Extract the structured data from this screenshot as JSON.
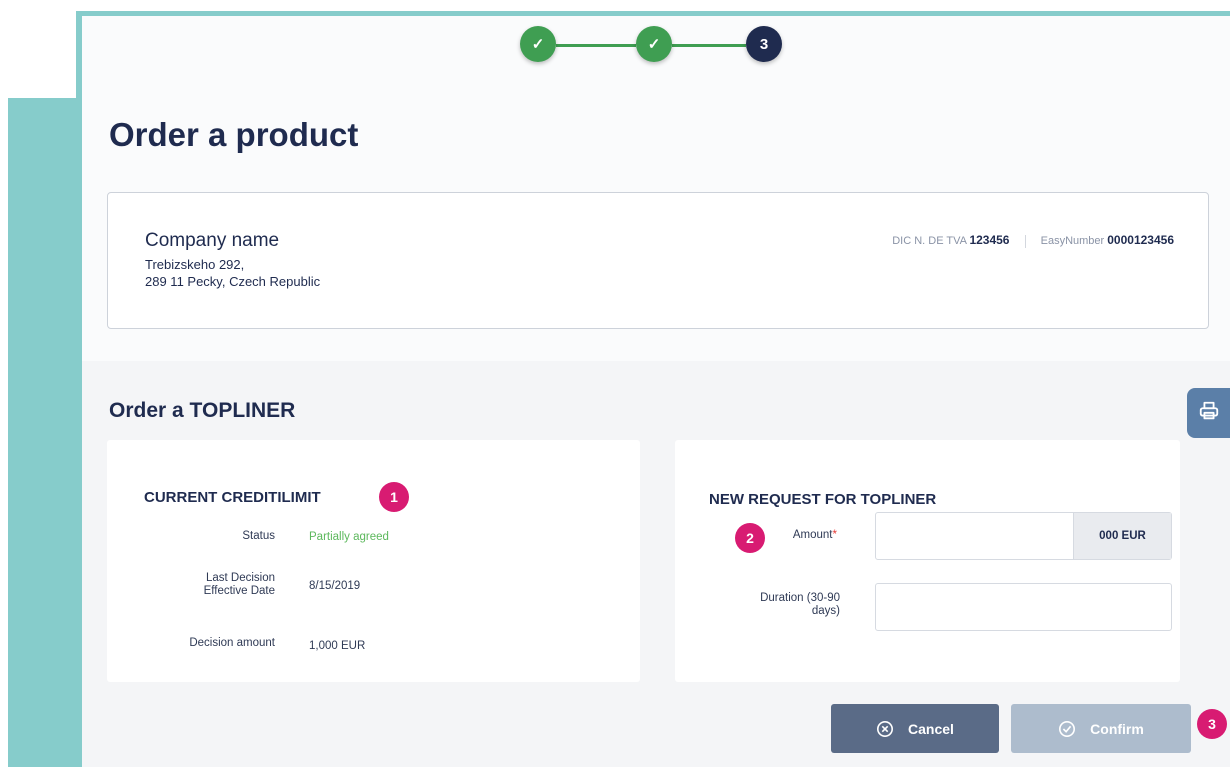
{
  "stepper": {
    "steps": [
      "✓",
      "✓",
      "3"
    ],
    "current_step": 3
  },
  "page_title": "Order a product",
  "company": {
    "name": "Company name",
    "address_line1": "Trebizskeho 292,",
    "address_line2": "289 11 Pecky, Czech Republic",
    "dic_label": "DIC N. DE TVA",
    "dic_value": "123456",
    "easy_label": "EasyNumber",
    "easy_value": "0000123456"
  },
  "section_title": "Order a TOPLINER",
  "print_icon": "printer-icon",
  "current_limit": {
    "title": "CURRENT CREDITILIMIT",
    "badge": "1",
    "status_label": "Status",
    "status_value": "Partially agreed",
    "last_decision_label_line1": "Last Decision",
    "last_decision_label_line2": "Effective Date",
    "last_decision_value": "8/15/2019",
    "decision_amount_label": "Decision amount",
    "decision_amount_value": "1,000 EUR"
  },
  "new_request": {
    "title": "NEW REQUEST FOR TOPLINER",
    "badge": "2",
    "amount_label": "Amount",
    "amount_required": "*",
    "amount_value": "",
    "amount_suffix": "000 EUR",
    "duration_label_line1": "Duration (30-90",
    "duration_label_line2": "days)",
    "duration_value": ""
  },
  "actions": {
    "cancel_label": "Cancel",
    "confirm_label": "Confirm",
    "badge": "3"
  },
  "colors": {
    "accent_teal": "#86cccb",
    "step_done": "#3f9e52",
    "step_current": "#1f2b4f",
    "badge": "#d81b72",
    "status_green": "#5cb85c",
    "cancel_bg": "#5a6b87",
    "confirm_bg": "#adbccd",
    "print_bg": "#5b7fa8"
  }
}
